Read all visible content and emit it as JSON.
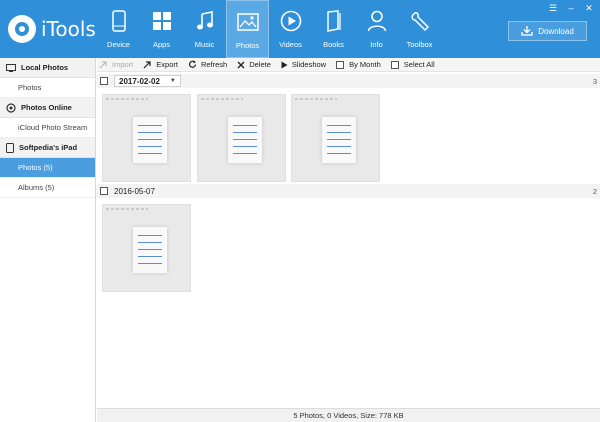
{
  "app": {
    "name": "iTools"
  },
  "nav": {
    "items": [
      {
        "label": "Device",
        "icon": "device-icon"
      },
      {
        "label": "Apps",
        "icon": "apps-icon"
      },
      {
        "label": "Music",
        "icon": "music-icon"
      },
      {
        "label": "Photos",
        "icon": "photos-icon",
        "active": true
      },
      {
        "label": "Videos",
        "icon": "videos-icon"
      },
      {
        "label": "Books",
        "icon": "books-icon"
      },
      {
        "label": "Info",
        "icon": "info-icon"
      },
      {
        "label": "Toolbox",
        "icon": "toolbox-icon"
      }
    ],
    "download_label": "Download"
  },
  "window": {
    "controls": [
      "☰",
      "–",
      "✕"
    ]
  },
  "sidebar": {
    "sections": [
      {
        "title": "Local Photos",
        "icon": "local-photos-icon",
        "items": [
          "Photos"
        ]
      },
      {
        "title": "Photos Online",
        "icon": "cloud-icon",
        "items": [
          "iCloud Photo Stream"
        ]
      },
      {
        "title": "Softpedia's iPad",
        "icon": "ipad-icon",
        "items": [
          "Photos (5)",
          "Albums (5)"
        ]
      }
    ],
    "active_item": "Photos (5)"
  },
  "toolbar": {
    "import": "Import",
    "export": "Export",
    "refresh": "Refresh",
    "delete": "Delete",
    "slideshow": "Slideshow",
    "by_month": "By Month",
    "select_all": "Select All"
  },
  "groups": [
    {
      "date": "2017-02-02",
      "count": "3",
      "photos": 3
    },
    {
      "date": "2016-05-07",
      "count": "2",
      "photos": 1
    }
  ],
  "status": {
    "text": "5 Photos, 0 Videos, Size: 778 KB"
  },
  "colors": {
    "header": "#2f8fd8",
    "active_sidebar": "#4a9ee0",
    "nav_active": "#5aa8e4"
  }
}
